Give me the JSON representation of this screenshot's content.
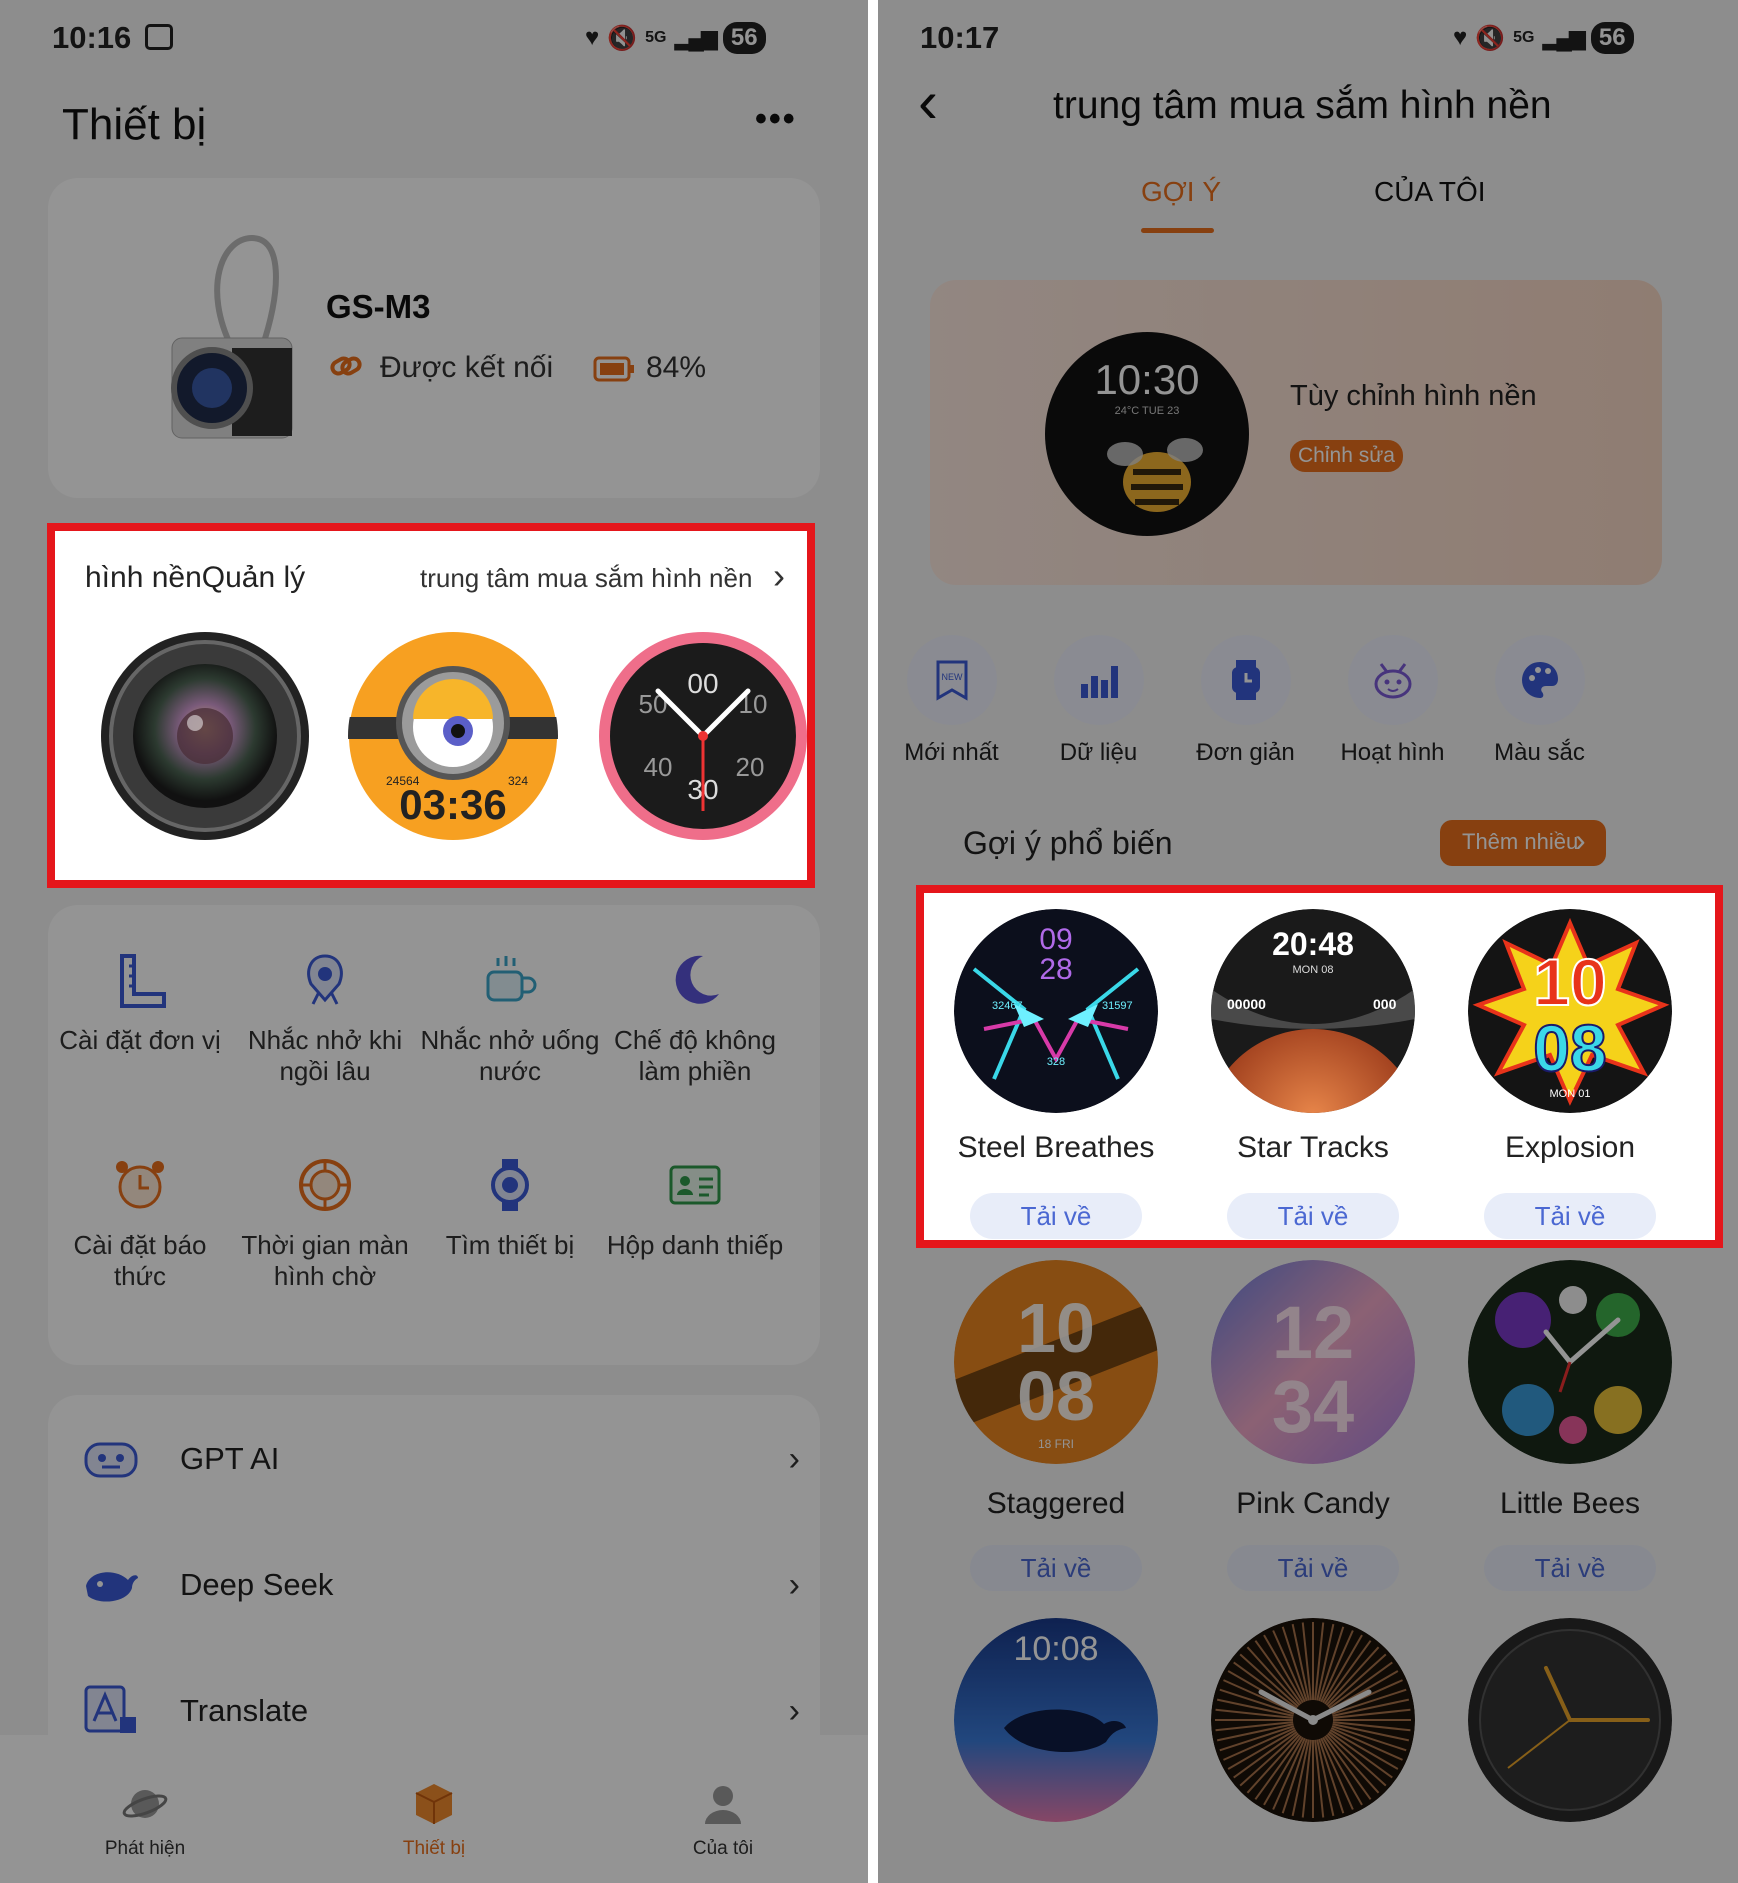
{
  "left": {
    "status": {
      "time": "10:16",
      "battery": "56",
      "network": "5G"
    },
    "header": {
      "title": "Thiết bị",
      "more": "•••"
    },
    "device": {
      "name": "GS-M3",
      "status": "Được kết nối",
      "battery": "84%"
    },
    "wallpaper": {
      "title": "hình nềnQuản lý",
      "shop_link": "trung tâm mua sắm hình nền",
      "chev": "›",
      "minion_time": "03:36",
      "minion_steps": "24564",
      "minion_kcal": "324",
      "pink_marks": [
        "00",
        "30",
        "40",
        "20",
        "50",
        "10"
      ]
    },
    "grid": [
      {
        "label": "Cài đặt đơn vị",
        "icon": "ruler-icon"
      },
      {
        "label": "Nhắc nhở khi ngồi lâu",
        "icon": "sitting-icon"
      },
      {
        "label": "Nhắc nhở uống nước",
        "icon": "cup-icon"
      },
      {
        "label": "Chế độ không làm phiền",
        "icon": "moon-icon"
      },
      {
        "label": "Cài đặt báo thức",
        "icon": "alarm-icon"
      },
      {
        "label": "Thời gian màn hình chờ",
        "icon": "screen-timer-icon"
      },
      {
        "label": "Tìm thiết bị",
        "icon": "find-device-icon"
      },
      {
        "label": "Hộp danh thiếp",
        "icon": "card-icon"
      }
    ],
    "list": [
      {
        "label": "GPT AI",
        "icon": "robot-icon"
      },
      {
        "label": "Deep Seek",
        "icon": "whale-icon"
      },
      {
        "label": "Translate",
        "icon": "translate-icon"
      }
    ],
    "nav": [
      {
        "label": "Phát hiện",
        "icon": "planet-icon",
        "active": false
      },
      {
        "label": "Thiết bị",
        "icon": "box-icon",
        "active": true
      },
      {
        "label": "Của tôi",
        "icon": "person-icon",
        "active": false
      }
    ]
  },
  "right": {
    "status": {
      "time": "10:17",
      "battery": "56",
      "network": "5G"
    },
    "header": {
      "title": "trung tâm mua sắm hình nền",
      "back": "‹"
    },
    "tabs": [
      {
        "label": "GỢI Ý",
        "active": true
      },
      {
        "label": "CỦA TÔI",
        "active": false
      }
    ],
    "custom": {
      "time": "10:30",
      "sub": "24°C TUE 23",
      "label": "Tùy chỉnh hình nền",
      "edit": "Chỉnh sửa"
    },
    "categories": [
      {
        "label": "Mới nhất",
        "icon": "new-icon"
      },
      {
        "label": "Dữ liệu",
        "icon": "bar-chart-icon"
      },
      {
        "label": "Đơn giản",
        "icon": "watch-icon"
      },
      {
        "label": "Hoạt hình",
        "icon": "cartoon-icon"
      },
      {
        "label": "Màu sắc",
        "icon": "palette-icon"
      }
    ],
    "popular": {
      "title": "Gợi ý phổ biến",
      "more": "Thêm nhiều"
    },
    "faces": [
      {
        "name": "Steel Breathes",
        "download": "Tải về",
        "time1": "09",
        "time2": "28",
        "left": "32467",
        "right": "31597",
        "bottom": "328"
      },
      {
        "name": "Star Tracks",
        "download": "Tải về",
        "time": "20:48",
        "date": "MON 08",
        "left": "00000",
        "right": "000"
      },
      {
        "name": "Explosion",
        "download": "Tải về",
        "time1": "10",
        "time2": "08",
        "date": "MON 01"
      },
      {
        "name": "Staggered",
        "download": "Tải về",
        "time1": "10",
        "time2": "08",
        "date": "18 FRI"
      },
      {
        "name": "Pink Candy",
        "download": "Tải về",
        "time1": "12",
        "time2": "34"
      },
      {
        "name": "Little Bees",
        "download": "Tải về"
      },
      {
        "time": "10:08"
      }
    ]
  },
  "colors": {
    "accent": "#e86f1c",
    "highlight": "#e5161b",
    "link_blue": "#4b68d2",
    "icon_blue": "#3b5bd6"
  }
}
